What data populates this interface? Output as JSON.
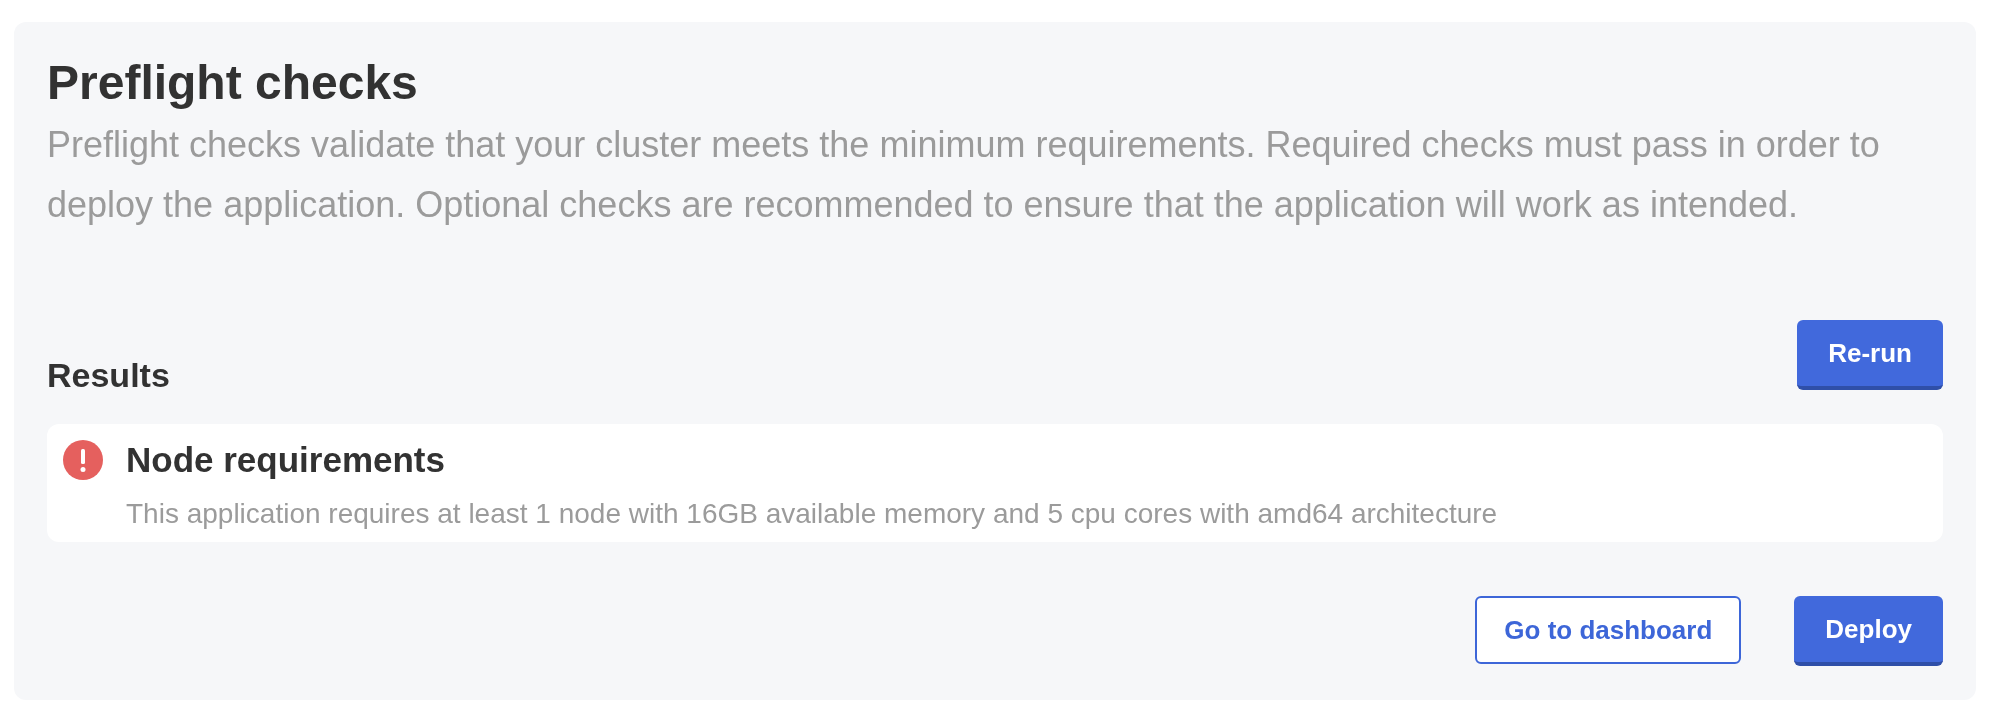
{
  "page": {
    "title": "Preflight checks",
    "description": "Preflight checks validate that your cluster meets the minimum requirements. Required checks must pass in order to deploy the application. Optional checks are recommended to ensure that the application will work as intended."
  },
  "results": {
    "heading": "Results",
    "rerun_button": "Re-run",
    "items": [
      {
        "kind": "error",
        "title": "Node requirements",
        "message": "This application requires at least 1 node with 16GB available memory and 5 cpu cores with amd64 architecture"
      }
    ]
  },
  "actions": [
    {
      "label": "Go to dashboard",
      "kind": "secondary"
    },
    {
      "label": "Deploy",
      "kind": "primary"
    }
  ]
}
